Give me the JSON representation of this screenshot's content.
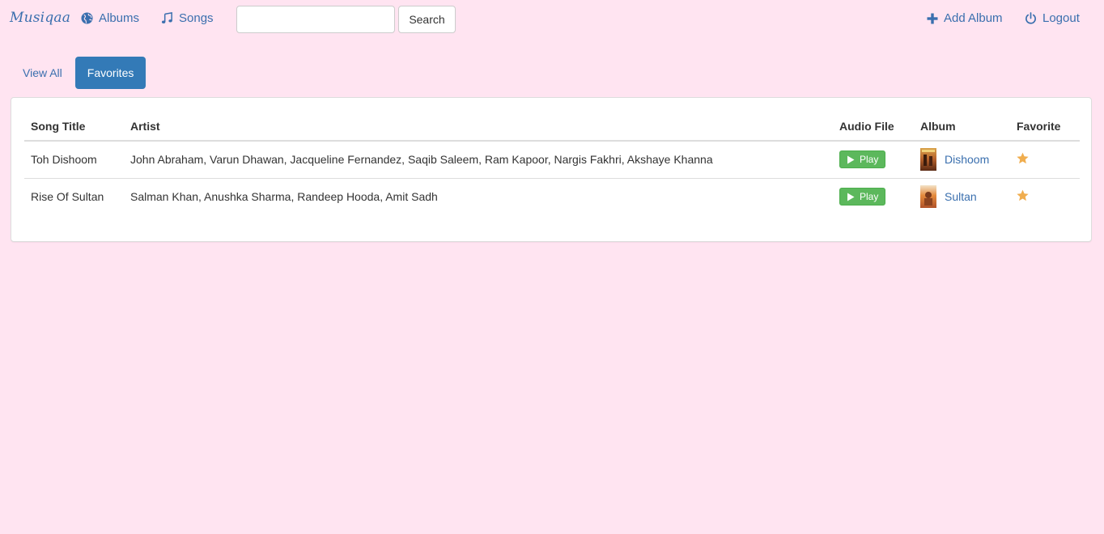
{
  "navbar": {
    "brand": "Musiqaa",
    "albums_label": "Albums",
    "songs_label": "Songs",
    "search_value": "",
    "search_placeholder": "",
    "search_button": "Search",
    "add_album_label": "Add Album",
    "logout_label": "Logout"
  },
  "tabs": [
    {
      "label": "View All",
      "active": false
    },
    {
      "label": "Favorites",
      "active": true
    }
  ],
  "table": {
    "headers": [
      "Song Title",
      "Artist",
      "Audio File",
      "Album",
      "Favorite"
    ],
    "rows": [
      {
        "title": "Toh Dishoom",
        "artist": "John Abraham, Varun Dhawan, Jacqueline Fernandez, Saqib Saleem, Ram Kapoor, Nargis Fakhri, Akshaye Khanna",
        "play_label": "Play",
        "album": "Dishoom",
        "favorite": true
      },
      {
        "title": "Rise Of Sultan",
        "artist": "Salman Khan, Anushka Sharma, Randeep Hooda, Amit Sadh",
        "play_label": "Play",
        "album": "Sultan",
        "favorite": true
      }
    ]
  },
  "colors": {
    "background": "#ffe4f1",
    "link": "#3a6fae",
    "primary": "#337ab7",
    "success": "#5cb85c",
    "star": "#f0ad4e"
  },
  "icons": {
    "albums": "globe-icon",
    "songs": "music-note-icon",
    "add_album": "plus-icon",
    "logout": "power-icon",
    "play": "play-icon",
    "favorite": "star-icon"
  }
}
